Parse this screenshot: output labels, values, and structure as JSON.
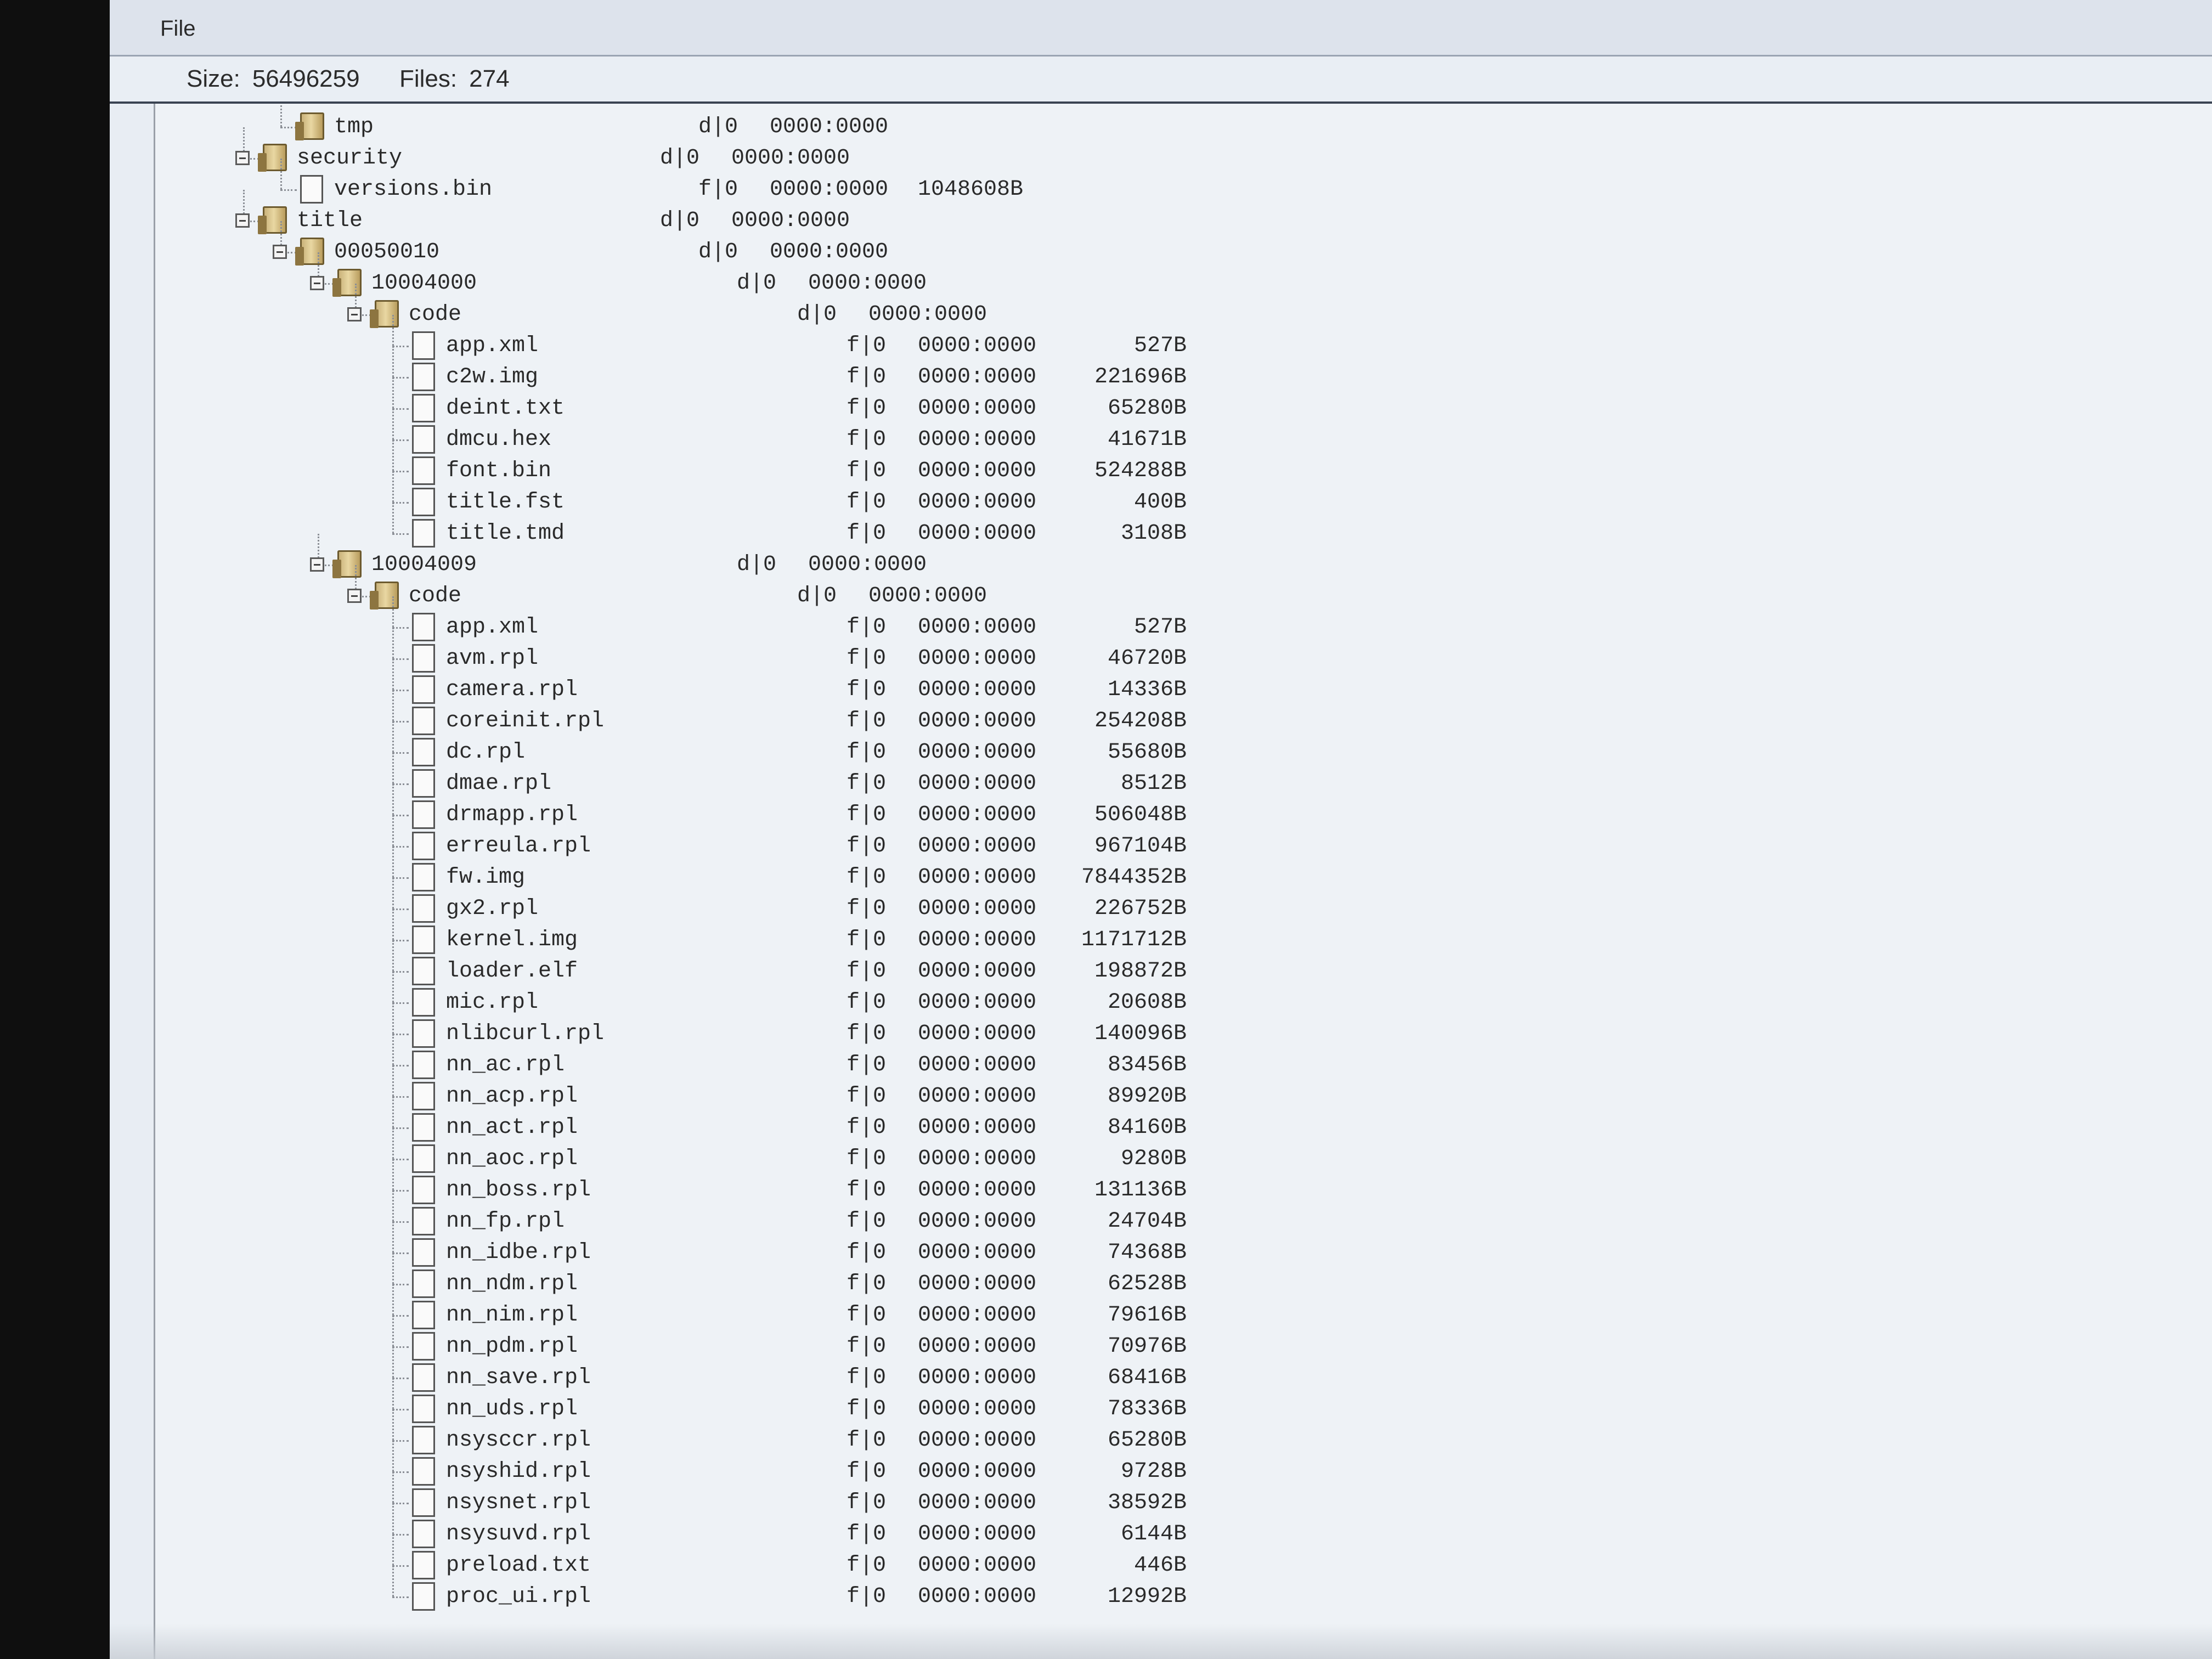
{
  "menu": {
    "file": "File"
  },
  "info": {
    "size_label": "Size:",
    "size_value": "56496259",
    "files_label": "Files:",
    "files_value": "274"
  },
  "entries": [
    {
      "depth": 3,
      "kind": "folder",
      "expander": false,
      "name": "tmp",
      "type": "d|0",
      "perm": "0000:0000",
      "size": ""
    },
    {
      "depth": 2,
      "kind": "folder",
      "expander": true,
      "name": "security",
      "type": "d|0",
      "perm": "0000:0000",
      "size": ""
    },
    {
      "depth": 3,
      "kind": "file",
      "expander": false,
      "name": "versions.bin",
      "type": "f|0",
      "perm": "0000:0000",
      "size": "1048608B"
    },
    {
      "depth": 2,
      "kind": "folder",
      "expander": true,
      "name": "title",
      "type": "d|0",
      "perm": "0000:0000",
      "size": ""
    },
    {
      "depth": 3,
      "kind": "folder",
      "expander": true,
      "name": "00050010",
      "type": "d|0",
      "perm": "0000:0000",
      "size": ""
    },
    {
      "depth": 4,
      "kind": "folder",
      "expander": true,
      "name": "10004000",
      "type": "d|0",
      "perm": "0000:0000",
      "size": ""
    },
    {
      "depth": 5,
      "kind": "folder",
      "expander": true,
      "name": "code",
      "type": "d|0",
      "perm": "0000:0000",
      "size": ""
    },
    {
      "depth": 6,
      "kind": "file",
      "expander": false,
      "name": "app.xml",
      "type": "f|0",
      "perm": "0000:0000",
      "size": "527B"
    },
    {
      "depth": 6,
      "kind": "file",
      "expander": false,
      "name": "c2w.img",
      "type": "f|0",
      "perm": "0000:0000",
      "size": "221696B"
    },
    {
      "depth": 6,
      "kind": "file",
      "expander": false,
      "name": "deint.txt",
      "type": "f|0",
      "perm": "0000:0000",
      "size": "65280B"
    },
    {
      "depth": 6,
      "kind": "file",
      "expander": false,
      "name": "dmcu.hex",
      "type": "f|0",
      "perm": "0000:0000",
      "size": "41671B"
    },
    {
      "depth": 6,
      "kind": "file",
      "expander": false,
      "name": "font.bin",
      "type": "f|0",
      "perm": "0000:0000",
      "size": "524288B"
    },
    {
      "depth": 6,
      "kind": "file",
      "expander": false,
      "name": "title.fst",
      "type": "f|0",
      "perm": "0000:0000",
      "size": "400B"
    },
    {
      "depth": 6,
      "kind": "file",
      "expander": false,
      "name": "title.tmd",
      "type": "f|0",
      "perm": "0000:0000",
      "size": "3108B"
    },
    {
      "depth": 4,
      "kind": "folder",
      "expander": true,
      "name": "10004009",
      "type": "d|0",
      "perm": "0000:0000",
      "size": ""
    },
    {
      "depth": 5,
      "kind": "folder",
      "expander": true,
      "name": "code",
      "type": "d|0",
      "perm": "0000:0000",
      "size": ""
    },
    {
      "depth": 6,
      "kind": "file",
      "expander": false,
      "name": "app.xml",
      "type": "f|0",
      "perm": "0000:0000",
      "size": "527B"
    },
    {
      "depth": 6,
      "kind": "file",
      "expander": false,
      "name": "avm.rpl",
      "type": "f|0",
      "perm": "0000:0000",
      "size": "46720B"
    },
    {
      "depth": 6,
      "kind": "file",
      "expander": false,
      "name": "camera.rpl",
      "type": "f|0",
      "perm": "0000:0000",
      "size": "14336B"
    },
    {
      "depth": 6,
      "kind": "file",
      "expander": false,
      "name": "coreinit.rpl",
      "type": "f|0",
      "perm": "0000:0000",
      "size": "254208B"
    },
    {
      "depth": 6,
      "kind": "file",
      "expander": false,
      "name": "dc.rpl",
      "type": "f|0",
      "perm": "0000:0000",
      "size": "55680B"
    },
    {
      "depth": 6,
      "kind": "file",
      "expander": false,
      "name": "dmae.rpl",
      "type": "f|0",
      "perm": "0000:0000",
      "size": "8512B"
    },
    {
      "depth": 6,
      "kind": "file",
      "expander": false,
      "name": "drmapp.rpl",
      "type": "f|0",
      "perm": "0000:0000",
      "size": "506048B"
    },
    {
      "depth": 6,
      "kind": "file",
      "expander": false,
      "name": "erreula.rpl",
      "type": "f|0",
      "perm": "0000:0000",
      "size": "967104B"
    },
    {
      "depth": 6,
      "kind": "file",
      "expander": false,
      "name": "fw.img",
      "type": "f|0",
      "perm": "0000:0000",
      "size": "7844352B"
    },
    {
      "depth": 6,
      "kind": "file",
      "expander": false,
      "name": "gx2.rpl",
      "type": "f|0",
      "perm": "0000:0000",
      "size": "226752B"
    },
    {
      "depth": 6,
      "kind": "file",
      "expander": false,
      "name": "kernel.img",
      "type": "f|0",
      "perm": "0000:0000",
      "size": "1171712B"
    },
    {
      "depth": 6,
      "kind": "file",
      "expander": false,
      "name": "loader.elf",
      "type": "f|0",
      "perm": "0000:0000",
      "size": "198872B"
    },
    {
      "depth": 6,
      "kind": "file",
      "expander": false,
      "name": "mic.rpl",
      "type": "f|0",
      "perm": "0000:0000",
      "size": "20608B"
    },
    {
      "depth": 6,
      "kind": "file",
      "expander": false,
      "name": "nlibcurl.rpl",
      "type": "f|0",
      "perm": "0000:0000",
      "size": "140096B"
    },
    {
      "depth": 6,
      "kind": "file",
      "expander": false,
      "name": "nn_ac.rpl",
      "type": "f|0",
      "perm": "0000:0000",
      "size": "83456B"
    },
    {
      "depth": 6,
      "kind": "file",
      "expander": false,
      "name": "nn_acp.rpl",
      "type": "f|0",
      "perm": "0000:0000",
      "size": "89920B"
    },
    {
      "depth": 6,
      "kind": "file",
      "expander": false,
      "name": "nn_act.rpl",
      "type": "f|0",
      "perm": "0000:0000",
      "size": "84160B"
    },
    {
      "depth": 6,
      "kind": "file",
      "expander": false,
      "name": "nn_aoc.rpl",
      "type": "f|0",
      "perm": "0000:0000",
      "size": "9280B"
    },
    {
      "depth": 6,
      "kind": "file",
      "expander": false,
      "name": "nn_boss.rpl",
      "type": "f|0",
      "perm": "0000:0000",
      "size": "131136B"
    },
    {
      "depth": 6,
      "kind": "file",
      "expander": false,
      "name": "nn_fp.rpl",
      "type": "f|0",
      "perm": "0000:0000",
      "size": "24704B"
    },
    {
      "depth": 6,
      "kind": "file",
      "expander": false,
      "name": "nn_idbe.rpl",
      "type": "f|0",
      "perm": "0000:0000",
      "size": "74368B"
    },
    {
      "depth": 6,
      "kind": "file",
      "expander": false,
      "name": "nn_ndm.rpl",
      "type": "f|0",
      "perm": "0000:0000",
      "size": "62528B"
    },
    {
      "depth": 6,
      "kind": "file",
      "expander": false,
      "name": "nn_nim.rpl",
      "type": "f|0",
      "perm": "0000:0000",
      "size": "79616B"
    },
    {
      "depth": 6,
      "kind": "file",
      "expander": false,
      "name": "nn_pdm.rpl",
      "type": "f|0",
      "perm": "0000:0000",
      "size": "70976B"
    },
    {
      "depth": 6,
      "kind": "file",
      "expander": false,
      "name": "nn_save.rpl",
      "type": "f|0",
      "perm": "0000:0000",
      "size": "68416B"
    },
    {
      "depth": 6,
      "kind": "file",
      "expander": false,
      "name": "nn_uds.rpl",
      "type": "f|0",
      "perm": "0000:0000",
      "size": "78336B"
    },
    {
      "depth": 6,
      "kind": "file",
      "expander": false,
      "name": "nsysccr.rpl",
      "type": "f|0",
      "perm": "0000:0000",
      "size": "65280B"
    },
    {
      "depth": 6,
      "kind": "file",
      "expander": false,
      "name": "nsyshid.rpl",
      "type": "f|0",
      "perm": "0000:0000",
      "size": "9728B"
    },
    {
      "depth": 6,
      "kind": "file",
      "expander": false,
      "name": "nsysnet.rpl",
      "type": "f|0",
      "perm": "0000:0000",
      "size": "38592B"
    },
    {
      "depth": 6,
      "kind": "file",
      "expander": false,
      "name": "nsysuvd.rpl",
      "type": "f|0",
      "perm": "0000:0000",
      "size": "6144B"
    },
    {
      "depth": 6,
      "kind": "file",
      "expander": false,
      "name": "preload.txt",
      "type": "f|0",
      "perm": "0000:0000",
      "size": "446B"
    },
    {
      "depth": 6,
      "kind": "file",
      "expander": false,
      "name": "proc_ui.rpl",
      "type": "f|0",
      "perm": "0000:0000",
      "size": "12992B"
    }
  ]
}
